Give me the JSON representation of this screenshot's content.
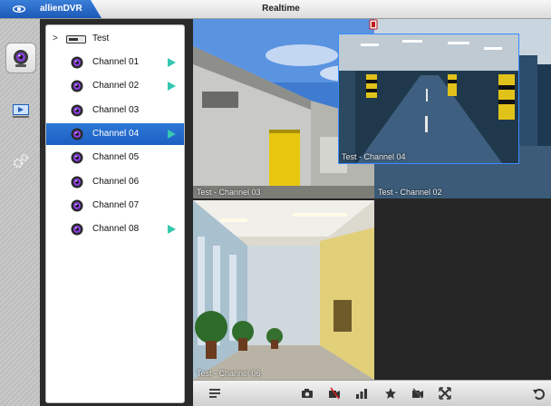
{
  "app": {
    "name": "allienDVR",
    "window_title": "Realtime"
  },
  "rail": {
    "items": [
      {
        "name": "live-view",
        "icon": "camera-lens-icon",
        "active": true
      },
      {
        "name": "playback",
        "icon": "film-icon",
        "active": false
      },
      {
        "name": "settings",
        "icon": "gears-icon",
        "active": false
      }
    ]
  },
  "tree": {
    "root": {
      "label": "Test",
      "expanded": true
    },
    "channels": [
      {
        "label": "Channel 01",
        "playing": true,
        "selected": false
      },
      {
        "label": "Channel 02",
        "playing": true,
        "selected": false
      },
      {
        "label": "Channel 03",
        "playing": false,
        "selected": false
      },
      {
        "label": "Channel 04",
        "playing": true,
        "selected": true
      },
      {
        "label": "Channel 05",
        "playing": false,
        "selected": false
      },
      {
        "label": "Channel 06",
        "playing": false,
        "selected": false
      },
      {
        "label": "Channel 07",
        "playing": false,
        "selected": false
      },
      {
        "label": "Channel 08",
        "playing": true,
        "selected": false
      }
    ]
  },
  "grid": {
    "tiles": [
      {
        "label": "Test - Channel 03",
        "scene": "building-exterior"
      },
      {
        "label": "Test - Channel 02",
        "scene": "parking-garage"
      },
      {
        "label": "Test - Channel 06",
        "scene": "hallway"
      },
      {
        "label": "Test - Channel 04",
        "scene": "parking-garage",
        "focused": true
      }
    ]
  },
  "toolbar": {
    "buttons": [
      "layout-icon",
      "snapshot-icon",
      "record-icon",
      "stream-quality-icon",
      "favorite-icon",
      "stop-all-icon",
      "fullscreen-icon",
      "back-icon"
    ]
  },
  "colors": {
    "accent": "#1c5fc3",
    "play": "#35c7b0",
    "selection": "#2f78d6"
  }
}
